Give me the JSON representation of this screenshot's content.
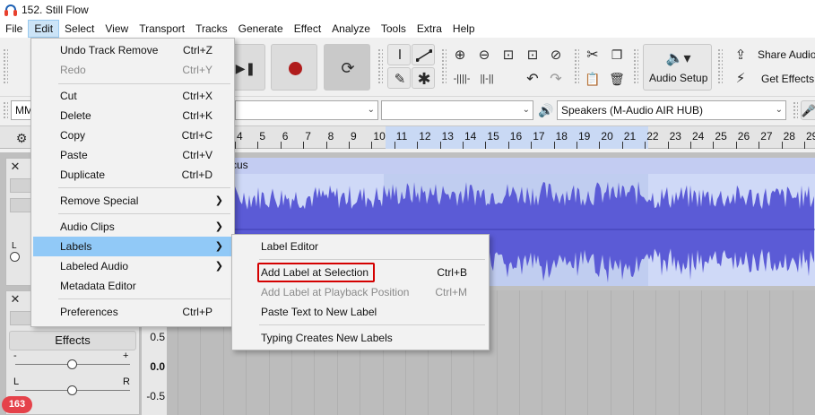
{
  "window": {
    "title": "152. Still Flow"
  },
  "menubar": [
    "File",
    "Edit",
    "Select",
    "View",
    "Transport",
    "Tracks",
    "Generate",
    "Effect",
    "Analyze",
    "Tools",
    "Extra",
    "Help"
  ],
  "toolbar": {
    "audio_setup": "Audio Setup",
    "share_audio": "Share Audio",
    "get_effects": "Get Effects"
  },
  "devices": {
    "host_partial": "MM",
    "playback_device": "Speakers (M-Audio AIR HUB)"
  },
  "ruler": {
    "ticks": [
      "4",
      "5",
      "6",
      "7",
      "8",
      "9",
      "10",
      "11",
      "12",
      "13",
      "14",
      "15",
      "16",
      "17",
      "18",
      "19",
      "20",
      "21",
      "22",
      "23",
      "24",
      "25",
      "26",
      "27",
      "28",
      "29"
    ]
  },
  "track1": {
    "name_partial": "cus"
  },
  "track2": {
    "effects_label": "Effects",
    "amp_labels": [
      "0.5",
      "0.0",
      "-0.5"
    ],
    "pan_left": "L",
    "pan_right": "R"
  },
  "edit_menu": {
    "items": [
      {
        "label": "Undo Track Remove",
        "shortcut": "Ctrl+Z",
        "disabled": false
      },
      {
        "label": "Redo",
        "shortcut": "Ctrl+Y",
        "disabled": true
      },
      {
        "label": "Cut",
        "shortcut": "Ctrl+X",
        "disabled": false
      },
      {
        "label": "Delete",
        "shortcut": "Ctrl+K",
        "disabled": false
      },
      {
        "label": "Copy",
        "shortcut": "Ctrl+C",
        "disabled": false
      },
      {
        "label": "Paste",
        "shortcut": "Ctrl+V",
        "disabled": false
      },
      {
        "label": "Duplicate",
        "shortcut": "Ctrl+D",
        "disabled": false
      },
      {
        "label": "Remove Special",
        "shortcut": "",
        "disabled": false
      },
      {
        "label": "Audio Clips",
        "shortcut": "",
        "disabled": false
      },
      {
        "label": "Labels",
        "shortcut": "",
        "disabled": false
      },
      {
        "label": "Labeled Audio",
        "shortcut": "",
        "disabled": false
      },
      {
        "label": "Metadata Editor",
        "shortcut": "",
        "disabled": false
      },
      {
        "label": "Preferences",
        "shortcut": "Ctrl+P",
        "disabled": false
      }
    ]
  },
  "labels_submenu": {
    "items": [
      {
        "label": "Label Editor",
        "shortcut": "",
        "disabled": false
      },
      {
        "label": "Add Label at Selection",
        "shortcut": "Ctrl+B",
        "disabled": false
      },
      {
        "label": "Add Label at Playback Position",
        "shortcut": "Ctrl+M",
        "disabled": true
      },
      {
        "label": "Paste Text to New Label",
        "shortcut": "",
        "disabled": false
      },
      {
        "label": "Typing Creates New Labels",
        "shortcut": "",
        "disabled": false
      }
    ]
  },
  "notification_badge": "163",
  "colors": {
    "waveform": "#5b5bd6",
    "selection": "#c9d9f4",
    "menu_hover": "#91c9f7",
    "highlight_box": "#d40000"
  }
}
